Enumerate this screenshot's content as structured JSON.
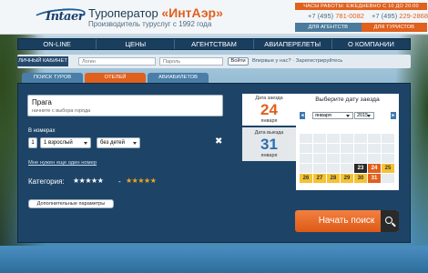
{
  "header": {
    "logo_text": "Intaer",
    "brand_prefix": "Туроператор",
    "brand_name": "«ИнтАэр»",
    "tagline": "Производитель туруслуг с 1992 года",
    "hours": "ЧАСЫ РАБОТЫ: ЕЖЕДНЕВНО С 10 ДО 20:00",
    "phone1_prefix": "+7 (495)",
    "phone1": "781-0082",
    "phone2_prefix": "+7 (495)",
    "phone2": "229-2868",
    "agents_label": "ДЛЯ АГЕНТСТВ",
    "tourists_label": "ДЛЯ ТУРИСТОВ"
  },
  "nav": [
    "ON-LINE",
    "ЦЕНЫ",
    "АГЕНТСТВАМ",
    "АВИАПЕРЕЛЕТЫ",
    "О КОМПАНИИ"
  ],
  "login": {
    "label": "ЛИЧНЫЙ КАБИНЕТ",
    "login_placeholder": "Логин",
    "password_placeholder": "Пароль",
    "submit": "Войти",
    "register": "Впервые у нас? · Зарегистрируйтесь"
  },
  "tabs": [
    "ПОИСК ТУРОВ",
    "ОТЕЛЕЙ",
    "АВИАБИЛЕТОВ"
  ],
  "form": {
    "destination_value": "Прага",
    "destination_hint": "начните с выбора города",
    "rooms_label": "В номерах",
    "room_number": "1",
    "adults": "1 взрослый",
    "kids": "без детей",
    "more_rooms": "Мне нужен еще один номер",
    "category_label": "Категория:",
    "stars_from": "★★★★★",
    "dash": "-",
    "stars_to": "★★★★★",
    "extra_params": "Дополнительные параметры"
  },
  "dates": {
    "checkin_label": "Дата заезда",
    "checkin_day": "24",
    "checkin_month": "января",
    "checkout_label": "Дата выезда",
    "checkout_day": "31",
    "checkout_month": "января"
  },
  "calendar": {
    "title": "Выберите дату заезда",
    "month": "января",
    "year": "2015",
    "prev": "◄",
    "next": "►",
    "rows": [
      [
        {
          "t": "",
          "c": "hd"
        },
        {
          "t": "",
          "c": "hd"
        },
        {
          "t": "",
          "c": "hd"
        },
        {
          "t": "",
          "c": "hd"
        },
        {
          "t": "",
          "c": "hd"
        },
        {
          "t": "",
          "c": "hd"
        },
        {
          "t": "",
          "c": "hd"
        }
      ],
      [
        {
          "t": "",
          "c": "d"
        },
        {
          "t": "",
          "c": "d"
        },
        {
          "t": "",
          "c": "d"
        },
        {
          "t": "",
          "c": "d"
        },
        {
          "t": "",
          "c": "d"
        },
        {
          "t": "",
          "c": "d"
        },
        {
          "t": "",
          "c": "d"
        }
      ],
      [
        {
          "t": "",
          "c": "d"
        },
        {
          "t": "",
          "c": "d"
        },
        {
          "t": "",
          "c": "d"
        },
        {
          "t": "",
          "c": "d"
        },
        {
          "t": "",
          "c": "d"
        },
        {
          "t": "",
          "c": "d"
        },
        {
          "t": "",
          "c": "d"
        }
      ],
      [
        {
          "t": "",
          "c": "d"
        },
        {
          "t": "",
          "c": "d"
        },
        {
          "t": "",
          "c": "d"
        },
        {
          "t": "",
          "c": "d"
        },
        {
          "t": "",
          "c": "d"
        },
        {
          "t": "",
          "c": "d"
        },
        {
          "t": "",
          "c": "d"
        }
      ],
      [
        {
          "t": "",
          "c": "d"
        },
        {
          "t": "",
          "c": "d"
        },
        {
          "t": "",
          "c": "d"
        },
        {
          "t": "",
          "c": "d"
        },
        {
          "t": "23",
          "c": "sel"
        },
        {
          "t": "24",
          "c": "end"
        },
        {
          "t": "25",
          "c": "rng"
        }
      ],
      [
        {
          "t": "26",
          "c": "rng"
        },
        {
          "t": "27",
          "c": "rng"
        },
        {
          "t": "28",
          "c": "rng"
        },
        {
          "t": "29",
          "c": "rng"
        },
        {
          "t": "30",
          "c": "rng"
        },
        {
          "t": "31",
          "c": "end"
        },
        {
          "t": "",
          "c": "pe"
        }
      ]
    ]
  },
  "search_button": "Начать поиск",
  "colors": {
    "accent": "#e0601e",
    "navy": "#1d4467",
    "highlight": "#f4c233"
  }
}
